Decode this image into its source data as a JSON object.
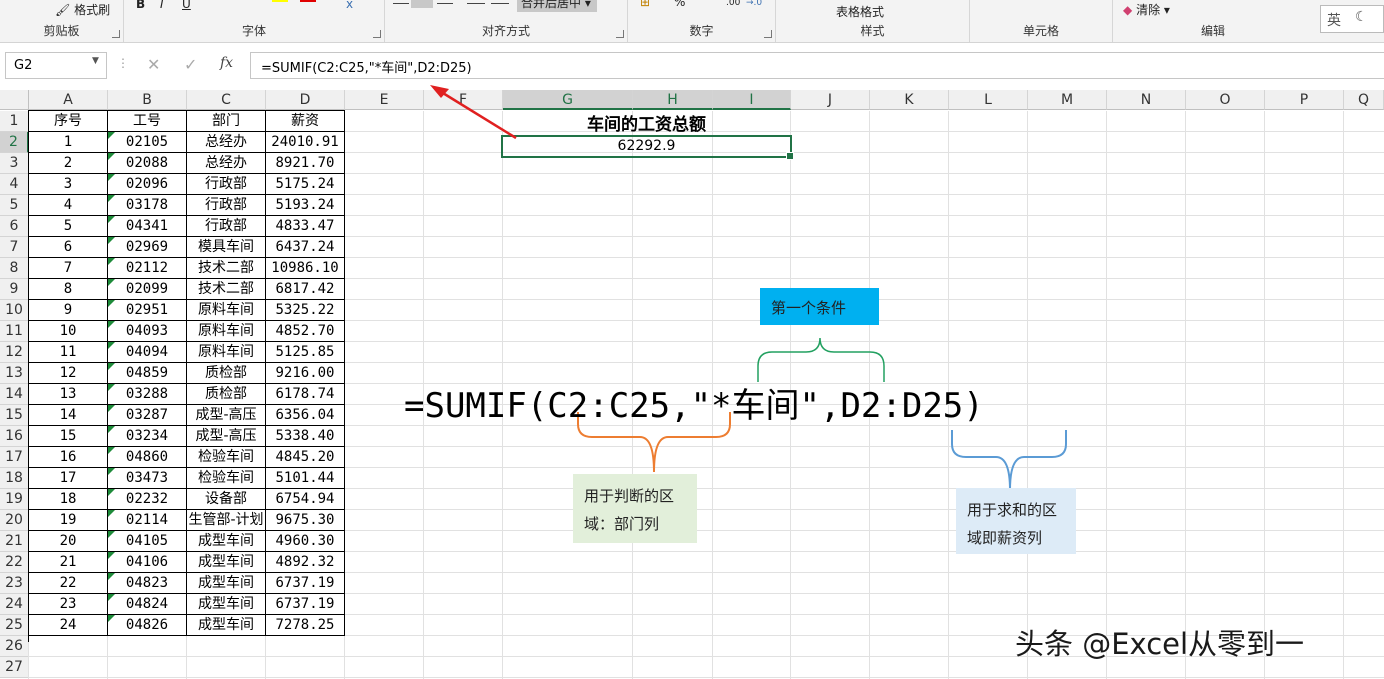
{
  "ribbon": {
    "clipboard_label": "剪贴板",
    "format_painter": "格式刷",
    "font_label": "字体",
    "alignment_label": "对齐方式",
    "merge_center": "合并后居中",
    "number_label": "数字",
    "table_format": "表格格式",
    "styles_label": "样式",
    "cells_label": "单元格",
    "clear": "清除",
    "editing_label": "编辑",
    "ime": "英"
  },
  "formula_bar": {
    "name_box": "G2",
    "formula": "=SUMIF(C2:C25,\"*车间\",D2:D25)"
  },
  "columns": [
    "A",
    "B",
    "C",
    "D",
    "E",
    "F",
    "G",
    "H",
    "I",
    "J",
    "K",
    "L",
    "M",
    "N",
    "O",
    "P",
    "Q"
  ],
  "rows": [
    "1",
    "2",
    "3",
    "4",
    "5",
    "6",
    "7",
    "8",
    "9",
    "10",
    "11",
    "12",
    "13",
    "14",
    "15",
    "16",
    "17",
    "18",
    "19",
    "20",
    "21",
    "22",
    "23",
    "24",
    "25",
    "26",
    "27"
  ],
  "table": {
    "headers": [
      "序号",
      "工号",
      "部门",
      "薪资"
    ],
    "rows": [
      [
        "1",
        "02105",
        "总经办",
        "24010.91"
      ],
      [
        "2",
        "02088",
        "总经办",
        "8921.70"
      ],
      [
        "3",
        "02096",
        "行政部",
        "5175.24"
      ],
      [
        "4",
        "03178",
        "行政部",
        "5193.24"
      ],
      [
        "5",
        "04341",
        "行政部",
        "4833.47"
      ],
      [
        "6",
        "02969",
        "模具车间",
        "6437.24"
      ],
      [
        "7",
        "02112",
        "技术二部",
        "10986.10"
      ],
      [
        "8",
        "02099",
        "技术二部",
        "6817.42"
      ],
      [
        "9",
        "02951",
        "原料车间",
        "5325.22"
      ],
      [
        "10",
        "04093",
        "原料车间",
        "4852.70"
      ],
      [
        "11",
        "04094",
        "原料车间",
        "5125.85"
      ],
      [
        "12",
        "04859",
        "质检部",
        "9216.00"
      ],
      [
        "13",
        "03288",
        "质检部",
        "6178.74"
      ],
      [
        "14",
        "03287",
        "成型-高压",
        "6356.04"
      ],
      [
        "15",
        "03234",
        "成型-高压",
        "5338.40"
      ],
      [
        "16",
        "04860",
        "检验车间",
        "4845.20"
      ],
      [
        "17",
        "03473",
        "检验车间",
        "5101.44"
      ],
      [
        "18",
        "02232",
        "设备部",
        "6754.94"
      ],
      [
        "19",
        "02114",
        "生管部-计划",
        "9675.30"
      ],
      [
        "20",
        "04105",
        "成型车间",
        "4960.30"
      ],
      [
        "21",
        "04106",
        "成型车间",
        "4892.32"
      ],
      [
        "22",
        "04823",
        "成型车间",
        "6737.19"
      ],
      [
        "23",
        "04824",
        "成型车间",
        "6737.19"
      ],
      [
        "24",
        "04826",
        "成型车间",
        "7278.25"
      ]
    ]
  },
  "result": {
    "title": "车间的工资总额",
    "value": "62292.9"
  },
  "annotation": {
    "formula_big": "=SUMIF(C2:C25,\"*车间\",D2:D25)",
    "cond1": "第一个条件",
    "range_note_line1": "用于判断的区",
    "range_note_line2": "域：部门列",
    "sum_note_line1": "用于求和的区",
    "sum_note_line2": "域即薪资列"
  },
  "watermark": "头条 @Excel从零到一",
  "colors": {
    "excel_green": "#217346",
    "cond_box": "#00b0f0",
    "range_box": "#e2efda",
    "sum_box": "#ddebf7",
    "arrow": "#e02020"
  }
}
